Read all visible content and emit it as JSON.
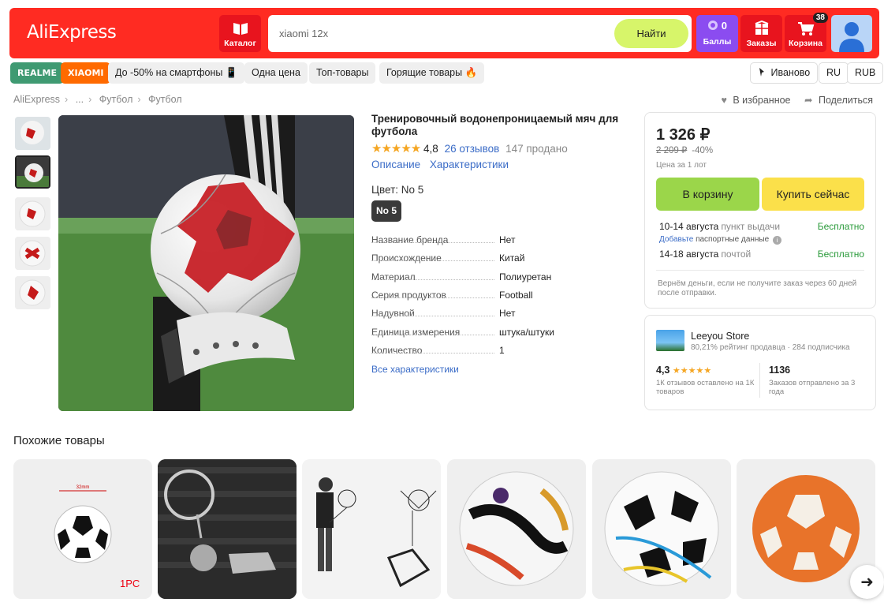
{
  "header": {
    "logo": "AliExpress",
    "catalog_label": "Каталог",
    "search_placeholder": "xiaomi 12x",
    "search_button": "Найти",
    "points_count": "0",
    "points_label": "Баллы",
    "orders_label": "Заказы",
    "cart_label": "Корзина",
    "cart_count": "38"
  },
  "chips": [
    "REALME",
    "XIAOMI",
    "До -50% на смартфоны 📱",
    "Одна цена",
    "Топ-товары",
    "Горящие товары 🔥"
  ],
  "locale": {
    "city": "Иваново",
    "lang": "RU",
    "currency": "RUB"
  },
  "breadcrumb": [
    "AliExpress",
    "...",
    "Футбол",
    "Футбол"
  ],
  "actions": {
    "favorite": "В избранное",
    "share": "Поделиться"
  },
  "product": {
    "title": "Тренировочный водонепроницаемый мяч для футбола",
    "stars": "★★★★★",
    "rating": "4,8",
    "reviews": "26 отзывов",
    "sold": "147 продано",
    "tab_description": "Описание",
    "tab_specs": "Характеристики",
    "color_label": "Цвет: No 5",
    "color_option": "No 5",
    "specs": [
      {
        "key": "Название бренда",
        "value": "Нет"
      },
      {
        "key": "Происхождение",
        "value": "Китай"
      },
      {
        "key": "Материал",
        "value": "Полиуретан"
      },
      {
        "key": "Серия продуктов",
        "value": "Football"
      },
      {
        "key": "Надувной",
        "value": "Нет"
      },
      {
        "key": "Единица измерения",
        "value": "штука/штуки"
      },
      {
        "key": "Количество",
        "value": "1"
      }
    ],
    "all_specs": "Все характеристики"
  },
  "buy": {
    "price": "1 326 ₽",
    "old_price": "2 209 ₽",
    "discount": "-40%",
    "per_lot": "Цена за 1 лот",
    "cart_button": "В корзину",
    "buy_button": "Купить сейчас",
    "delivery1_date": "10-14 августа",
    "delivery1_method": "пункт выдачи",
    "delivery1_price": "Бесплатно",
    "passport_link": "Добавьте",
    "passport_text": "паспортные данные",
    "delivery2_date": "14-18 августа",
    "delivery2_method": "почтой",
    "delivery2_price": "Бесплатно",
    "refund_note": "Вернём деньги, если не получите заказ через 60 дней после отправки."
  },
  "store": {
    "name": "Leeyou Store",
    "meta": "80,21% рейтинг продавца · 284 подписчика",
    "rating": "4,3",
    "rating_stars": "★★★★★",
    "rating_note": "1К отзывов оставлено на 1К товаров",
    "orders": "1136",
    "orders_note": "Заказов отправлено за 3 года"
  },
  "similar": {
    "title": "Похожие товары",
    "card1_label": "1PC",
    "card1_size": "32mm"
  },
  "colors": {
    "accent": "#ff2b22",
    "cart": "#9bd64a",
    "buy": "#fbe04a",
    "link": "#3b6cc7",
    "points": "#8b4cf0"
  }
}
